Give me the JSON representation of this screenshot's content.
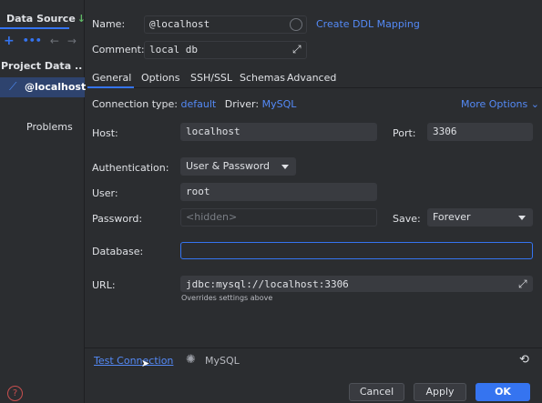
{
  "left": {
    "title": "Data Source",
    "project": "Project Data ..",
    "selected": "@localhost",
    "problems": "Problems"
  },
  "top": {
    "name_label": "Name:",
    "name_value": "@localhost",
    "ddl_link": "Create DDL Mapping",
    "comment_label": "Comment:",
    "comment_value": "local db"
  },
  "tabs": [
    "General",
    "Options",
    "SSH/SSL",
    "Schemas",
    "Advanced"
  ],
  "general": {
    "connection_type_label": "Connection type:",
    "connection_type_value": "default",
    "driver_label": "Driver:",
    "driver_value": "MySQL",
    "more_options": "More Options",
    "host_label": "Host:",
    "host_value": "localhost",
    "port_label": "Port:",
    "port_value": "3306",
    "auth_label": "Authentication:",
    "auth_value": "User & Password",
    "user_label": "User:",
    "user_value": "root",
    "password_label": "Password:",
    "password_placeholder": "<hidden>",
    "save_label": "Save:",
    "save_value": "Forever",
    "database_label": "Database:",
    "database_value": "",
    "url_label": "URL:",
    "url_value": "jdbc:mysql://localhost:3306",
    "url_note": "Overrides settings above"
  },
  "bottom": {
    "test_connection": "Test Connection",
    "status": "MySQL"
  },
  "buttons": {
    "cancel": "Cancel",
    "apply": "Apply",
    "ok": "OK"
  },
  "colors": {
    "background": "#2b2d30",
    "accent": "#3574f0",
    "link": "#548af7",
    "selection": "#2e436e"
  }
}
